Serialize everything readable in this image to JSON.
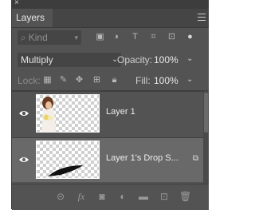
{
  "panel": {
    "close_glyph": "×",
    "tab_label": "Layers",
    "menu_icon": "menu-icon"
  },
  "filter": {
    "kind_placeholder": "Kind",
    "icons": [
      "image-filter-icon",
      "adjustment-filter-icon",
      "type-filter-icon",
      "shape-filter-icon",
      "smart-object-filter-icon",
      "filter-toggle-icon"
    ]
  },
  "blend": {
    "mode": "Multiply",
    "opacity_label": "Opacity:",
    "opacity_value": "100%"
  },
  "lock": {
    "label": "Lock:",
    "icons": [
      "lock-transparent-icon",
      "lock-image-icon",
      "lock-position-icon",
      "lock-artboard-icon",
      "lock-all-icon"
    ],
    "fill_label": "Fill:",
    "fill_value": "100%"
  },
  "layers": [
    {
      "name": "Layer 1",
      "visible": true,
      "selected": false
    },
    {
      "name": "Layer 1's Drop S...",
      "visible": true,
      "selected": true
    }
  ],
  "bottom_icons": [
    "link-layers-icon",
    "fx-icon",
    "add-mask-icon",
    "adjustment-layer-icon",
    "new-group-icon",
    "new-layer-icon",
    "delete-icon"
  ],
  "colors": {
    "panel_bg": "#535353",
    "selected_row": "#696969",
    "text": "#e8e8e8"
  }
}
